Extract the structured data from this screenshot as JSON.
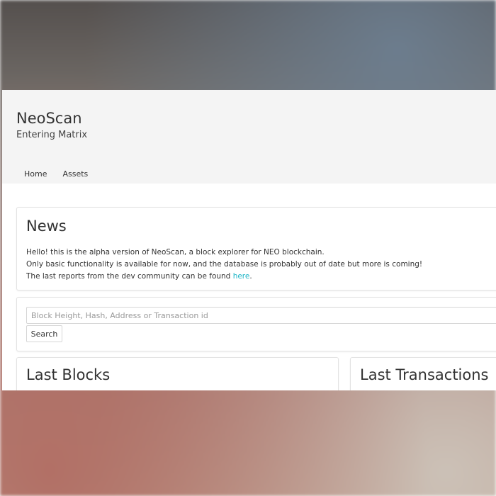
{
  "header": {
    "title": "NeoScan",
    "subtitle": "Entering Matrix",
    "nav": [
      {
        "label": "Home"
      },
      {
        "label": "Assets"
      }
    ]
  },
  "news": {
    "title": "News",
    "line1": "Hello! this is the alpha version of NeoScan, a block explorer for NEO blockchain.",
    "line2": "Only basic functionality is available for now, and the database is probably out of date but more is coming!",
    "line3_prefix": "The last reports from the dev community can be found ",
    "line3_link": "here",
    "line3_suffix": "."
  },
  "search": {
    "placeholder": "Block Height, Hash, Address or Transaction id",
    "button_label": "Search"
  },
  "sections": {
    "last_blocks": "Last Blocks",
    "last_transactions": "Last Transactions"
  },
  "colors": {
    "link": "#1bb4c6",
    "header_bg": "#f4f4f4"
  }
}
